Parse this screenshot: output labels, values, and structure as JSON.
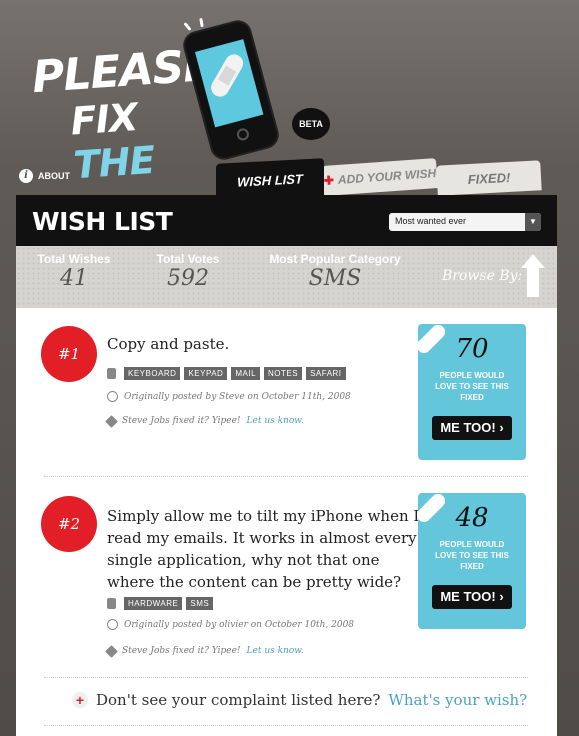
{
  "header": {
    "logo_line1": "PLEASE",
    "logo_line2a": "FIX ",
    "logo_line2b": "THE",
    "beta_label": "BETA",
    "about_label": "ABOUT"
  },
  "tabs": [
    {
      "label": "WISH LIST",
      "active": true
    },
    {
      "label": "ADD YOUR WISH",
      "icon": "plus-icon"
    },
    {
      "label": "FIXED!"
    }
  ],
  "panel": {
    "title": "WISH LIST",
    "sort_value": "Most wanted ever"
  },
  "stats": {
    "total_wishes_label": "Total Wishes",
    "total_wishes": "41",
    "total_votes_label": "Total Votes",
    "total_votes": "592",
    "popular_label": "Most Popular Category",
    "popular_value": "SMS",
    "browse_label": "Browse By:"
  },
  "wishes": [
    {
      "rank": "#1",
      "text": "Copy and paste.",
      "tags": [
        "KEYBOARD",
        "KEYPAD",
        "MAIL",
        "NOTES",
        "SAFARI"
      ],
      "posted": "Originally posted by Steve on October 11th, 2008",
      "fixed_prefix": "Steve Jobs fixed it? Yipee!",
      "fixed_link": "Let us know.",
      "votes": "70",
      "votes_caption": "PEOPLE WOULD LOVE TO SEE THIS FIXED",
      "button": "ME TOO! ›"
    },
    {
      "rank": "#2",
      "text_lines": [
        "Simply allow me to tilt my iPhone when I",
        "read my emails. It works in almost every",
        "single application, why not that one",
        "where the content can be pretty wide?"
      ],
      "tags": [
        "HARDWARE",
        "SMS"
      ],
      "posted": "Originally posted by olivier on October 10th, 2008",
      "fixed_prefix": "Steve Jobs fixed it? Yipee!",
      "fixed_link": "Let us know.",
      "votes": "48",
      "votes_caption": "PEOPLE WOULD LOVE TO SEE THIS FIXED",
      "button": "ME TOO! ›"
    }
  ],
  "footer": {
    "prompt": "Don't see your complaint listed here?",
    "link": "What's your wish?"
  },
  "colors": {
    "accent_red": "#e21f26",
    "accent_blue": "#64c6da",
    "link": "#4aa3c1"
  }
}
